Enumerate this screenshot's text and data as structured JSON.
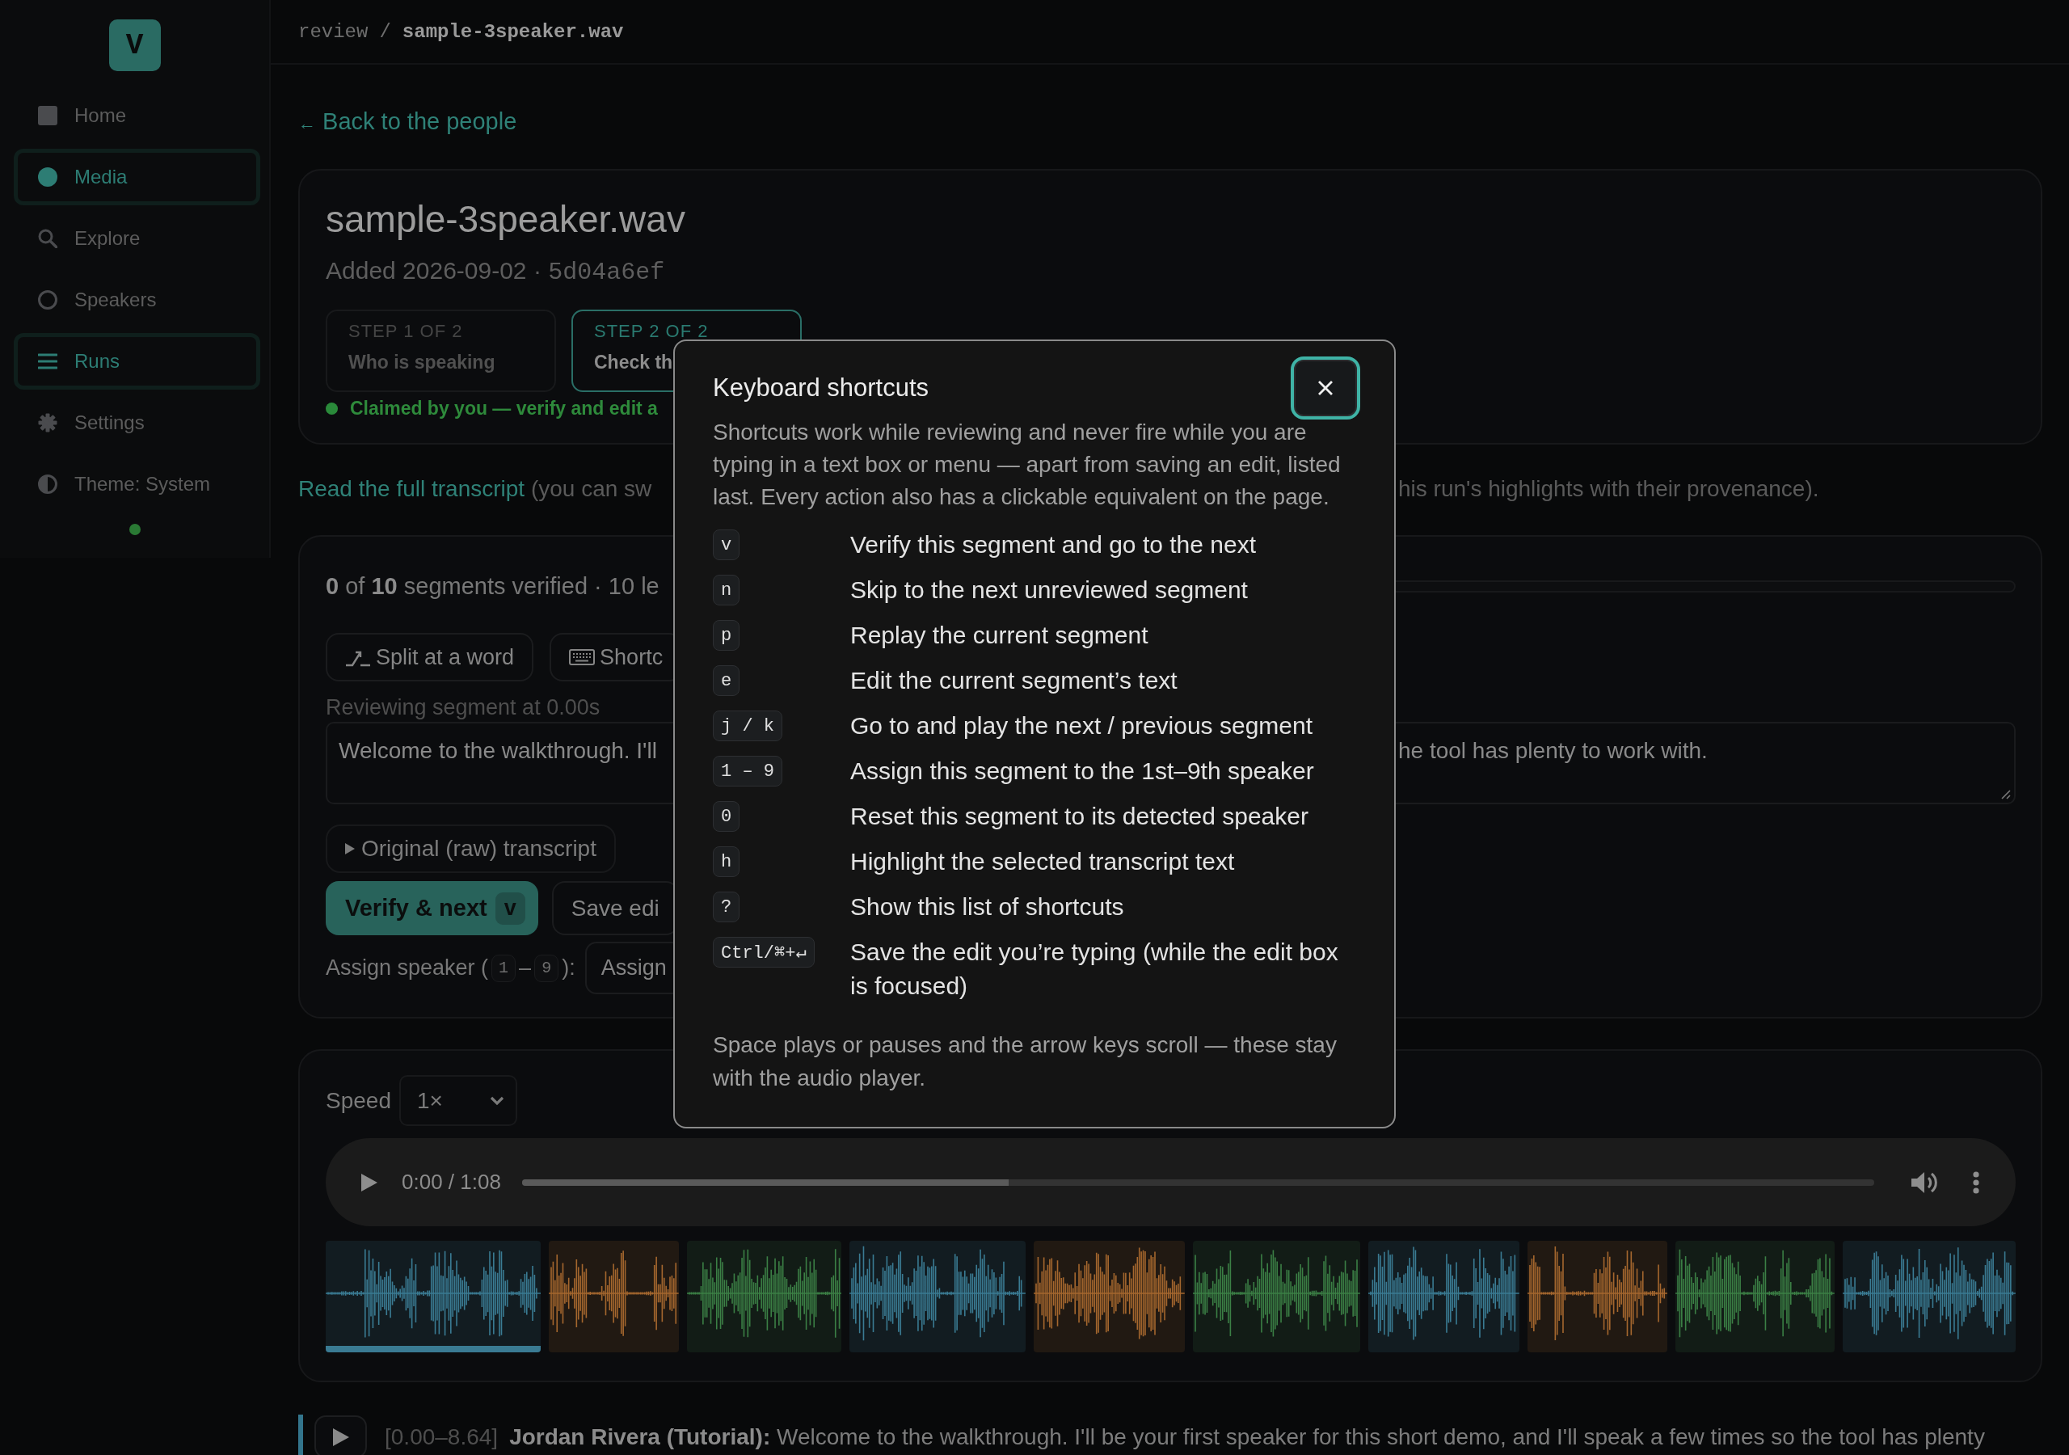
{
  "breadcrumb": {
    "parent": "review",
    "separator": "/",
    "current": "sample-3speaker.wav"
  },
  "sidebar": {
    "logo": "V",
    "items": [
      {
        "label": "Home",
        "selected": false
      },
      {
        "label": "Media",
        "selected": true
      },
      {
        "label": "Explore",
        "selected": false
      },
      {
        "label": "Speakers",
        "selected": false
      },
      {
        "label": "Runs",
        "selected": true
      },
      {
        "label": "Settings",
        "selected": false
      },
      {
        "label": "Theme: System",
        "selected": false
      }
    ]
  },
  "back_link": {
    "arrow": "←",
    "label": "Back to the people"
  },
  "media_card": {
    "title": "sample-3speaker.wav",
    "added": "Added 2026-09-02",
    "separator": "·",
    "hash": "5d04a6ef",
    "steps": [
      {
        "label": "STEP 1 OF 2",
        "title": "Who is speaking",
        "selected": false
      },
      {
        "label": "STEP 2 OF 2",
        "title": "Check th",
        "selected": true
      }
    ],
    "claim": "Claimed by you — verify and edit a"
  },
  "transcript_note": {
    "link": "Read the full transcript",
    "text_start": "(you can sw",
    "text_end": "his run's highlights with their provenance)."
  },
  "review_card": {
    "progress": {
      "text": "**0** of **10** segments verified · 10 le",
      "level": 0
    },
    "tools": [
      {
        "label": "Split at a word"
      },
      {
        "label": "Shortc"
      }
    ],
    "segment_label": "Reviewing segment at 0.00s",
    "editor": {
      "text_start": "Welcome to the walkthrough. I'll",
      "text_end": "he tool has plenty to work with."
    },
    "raw_toggle": "Original (raw) transcript",
    "verify": {
      "label": "Verify & next",
      "key": "v"
    },
    "save": "Save edi",
    "assign": {
      "label": "Assign speaker (",
      "key_from": "1",
      "dash": "–",
      "key_to": "9",
      "label_end": "):",
      "select": "Assign"
    }
  },
  "player_card": {
    "speed": {
      "label": "Speed",
      "value": "1×"
    },
    "player": {
      "time": "0:00 / 1:08",
      "level": 0.36
    },
    "segments": [
      {
        "color": "#3a7b93",
        "selected": true
      },
      {
        "color": "#a5672e",
        "selected": false
      },
      {
        "color": "#3b7f45",
        "selected": false
      },
      {
        "color": "#3a7b93",
        "selected": false
      },
      {
        "color": "#a5672e",
        "selected": false
      },
      {
        "color": "#3b7f45",
        "selected": false
      },
      {
        "color": "#3a7b93",
        "selected": false
      },
      {
        "color": "#a5672e",
        "selected": false
      },
      {
        "color": "#3b7f45",
        "selected": false
      },
      {
        "color": "#3a7b93",
        "selected": false
      }
    ]
  },
  "transcript": [
    {
      "time": "[0.00–8.64]",
      "text": "**Jordan Rivera (Tutorial):** Welcome to the walkthrough. I'll be your first speaker for this short demo, and I'll speak a few times so the tool has plenty",
      "color": "#33758c"
    }
  ],
  "shortcuts_dialog": {
    "title": "Keyboard shortcuts",
    "description": "Shortcuts work while reviewing and never fire while you are typing in a text box or menu — apart from saving an edit, listed last. Every action also has a clickable equivalent on the page.",
    "shortcuts": [
      {
        "keys": "v",
        "action": "Verify this segment and go to the next"
      },
      {
        "keys": "n",
        "action": "Skip to the next unreviewed segment"
      },
      {
        "keys": "p",
        "action": "Replay the current segment"
      },
      {
        "keys": "e",
        "action": "Edit the current segment’s text"
      },
      {
        "keys": "j / k",
        "action": "Go to and play the next / previous segment"
      },
      {
        "keys": "1 – 9",
        "action": "Assign this segment to the 1st–9th speaker"
      },
      {
        "keys": "0",
        "action": "Reset this segment to its detected speaker"
      },
      {
        "keys": "h",
        "action": "Highlight the selected transcript text"
      },
      {
        "keys": "?",
        "action": "Show this list of shortcuts"
      },
      {
        "keys": "Ctrl/⌘+↵",
        "action": "Save the edit you’re typing (while the edit box is focused)"
      }
    ],
    "footer": "Space plays or pauses and the arrow keys scroll — these stay with the audio player."
  }
}
